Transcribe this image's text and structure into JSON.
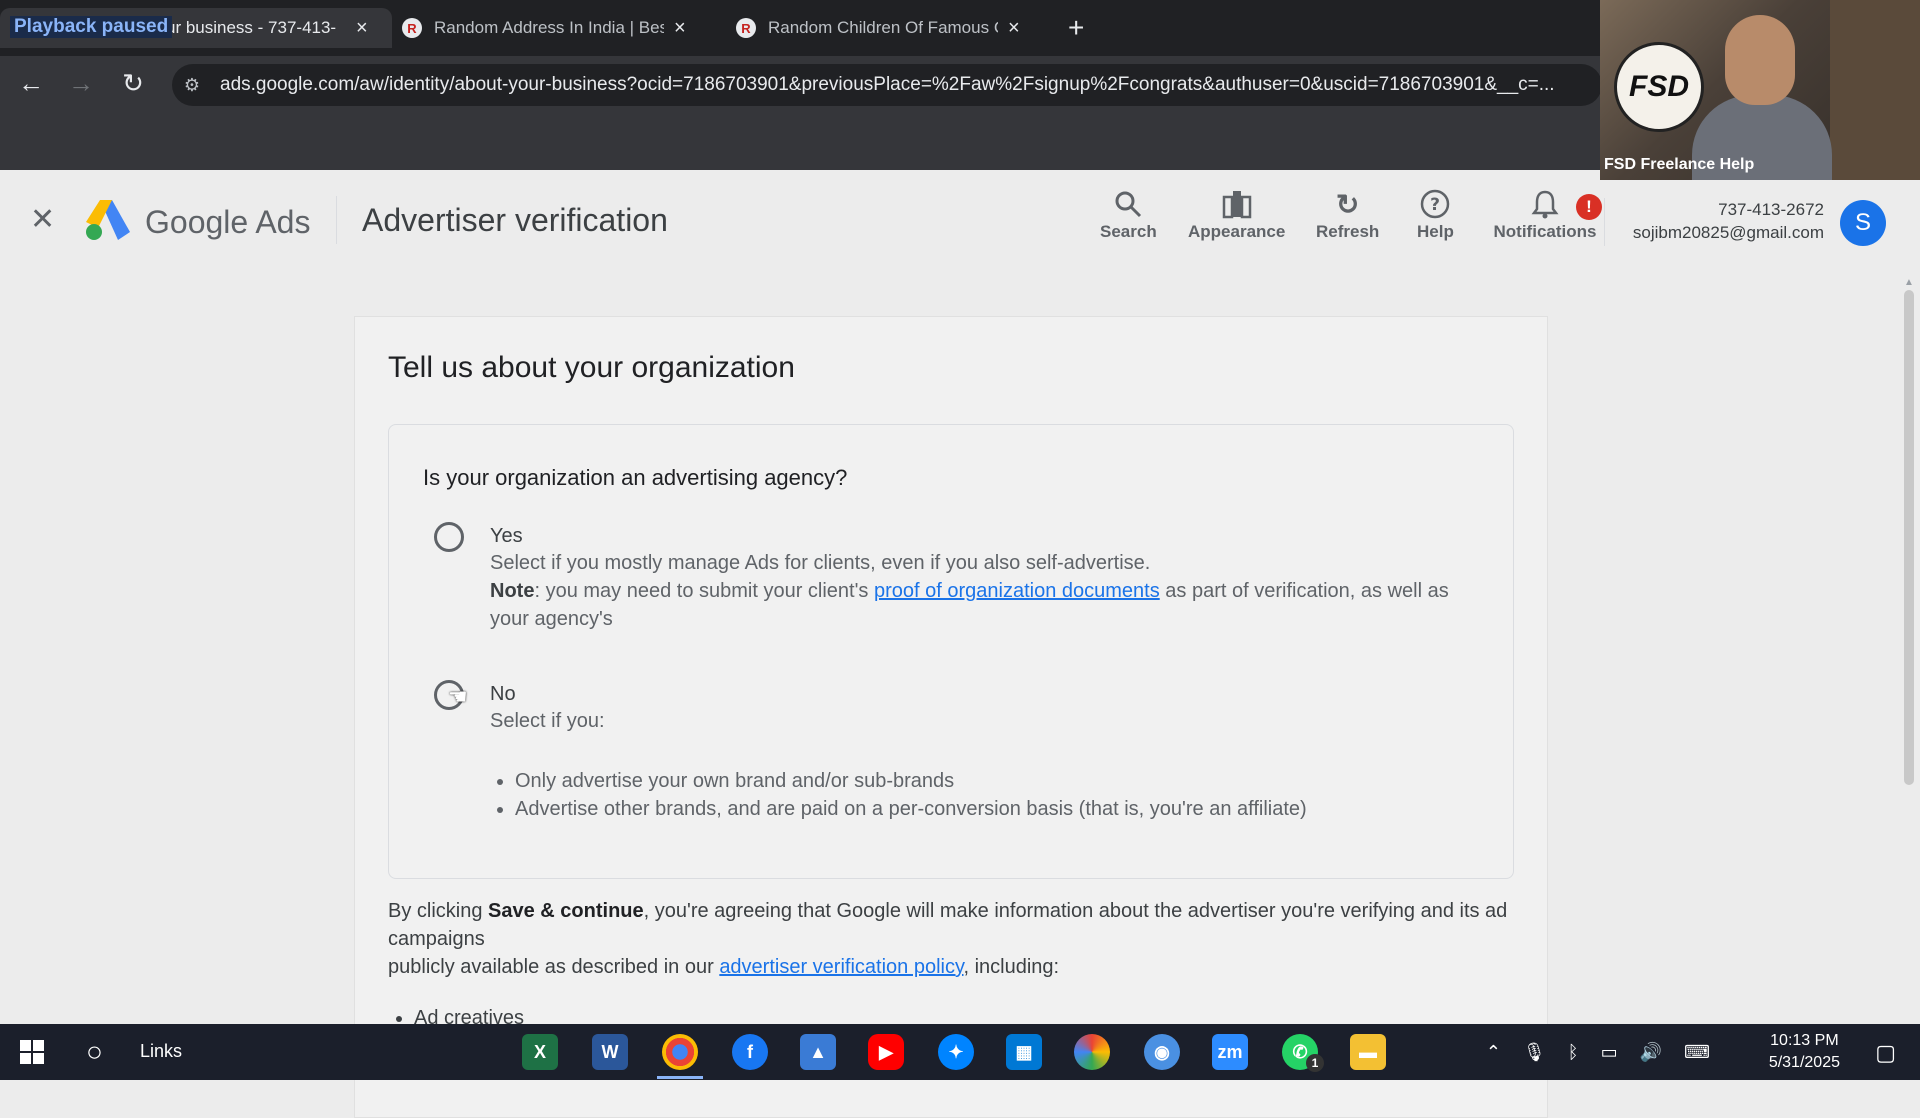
{
  "browser": {
    "overlay_text": "Playback paused",
    "tabs": [
      {
        "title": "ur business - 737-413-",
        "active": true
      },
      {
        "title": "Random Address In India | Best",
        "active": false,
        "favicon": "R"
      },
      {
        "title": "Random Children Of Famous C",
        "active": false,
        "favicon": "R"
      }
    ],
    "url": "ads.google.com/aw/identity/about-your-business?ocid=7186703901&previousPlace=%2Faw%2Fsignup%2Fcongrats&authuser=0&uscid=7186703901&__c=..."
  },
  "webcam": {
    "label": "FSD Freelance Help",
    "logo_text": "FSD"
  },
  "header": {
    "brand": "Google Ads",
    "page_title": "Advertiser verification",
    "buttons": {
      "search": "Search",
      "appearance": "Appearance",
      "refresh": "Refresh",
      "help": "Help",
      "notifications": "Notifications"
    },
    "notification_badge": "!",
    "account_phone": "737-413-2672",
    "account_email": "sojibm20825@gmail.com",
    "avatar_letter": "S"
  },
  "main": {
    "title": "Tell us about your organization",
    "question": "Is your organization an advertising agency?",
    "yes": {
      "label": "Yes",
      "desc": "Select if you mostly manage Ads for clients, even if you also self-advertise.",
      "note_label": "Note",
      "note_pre": ": you may need to submit your client's ",
      "note_link": "proof of organization documents",
      "note_post": " as part of verification, as well as your agency's"
    },
    "no": {
      "label": "No",
      "desc": "Select if you:",
      "bullets": [
        "Only advertise your own brand and/or sub-brands",
        "Advertise other brands, and are paid on a per-conversion basis (that is, you're an affiliate)"
      ]
    },
    "consent": {
      "pre": "By clicking ",
      "bold": "Save & continue",
      "mid": ", you're agreeing that Google will make information about the advertiser you're verifying and its ad campaigns",
      "line2_pre": "publicly available as described in our ",
      "link": "advertiser verification policy",
      "line2_post": ", including:",
      "list": [
        "Ad creatives"
      ]
    }
  },
  "taskbar": {
    "links_label": "Links",
    "time": "10:13 PM",
    "date": "5/31/2025",
    "whatsapp_badge": "1"
  },
  "colors": {
    "accent": "#1a73e8",
    "badge": "#d93025",
    "chrome_dark": "#202124"
  }
}
